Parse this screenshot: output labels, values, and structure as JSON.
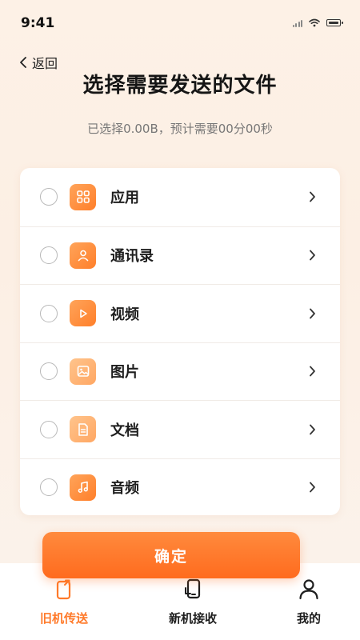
{
  "status_bar": {
    "time": "9:41"
  },
  "header": {
    "back_label": "返回",
    "title": "选择需要发送的文件",
    "subtitle": "已选择0.00B，预计需要00分00秒"
  },
  "file_types": [
    {
      "label": "应用",
      "icon": "apps-grid-icon"
    },
    {
      "label": "通讯录",
      "icon": "contact-person-icon"
    },
    {
      "label": "视频",
      "icon": "play-icon"
    },
    {
      "label": "图片",
      "icon": "image-icon"
    },
    {
      "label": "文档",
      "icon": "document-icon"
    },
    {
      "label": "音频",
      "icon": "music-note-icon"
    }
  ],
  "confirm_label": "确定",
  "bottom_nav": [
    {
      "label": "旧机传送",
      "icon": "phone-send-icon",
      "active": true
    },
    {
      "label": "新机接收",
      "icon": "phone-receive-icon",
      "active": false
    },
    {
      "label": "我的",
      "icon": "user-icon",
      "active": false
    }
  ],
  "colors": {
    "accent": "#ff7a2a",
    "accent_light": "#ffa45a",
    "background": "#fdf1e6"
  }
}
